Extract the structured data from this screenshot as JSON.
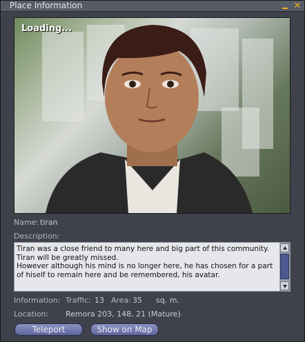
{
  "window": {
    "title": "Place Information"
  },
  "titlebar": {
    "minimize_icon": "minimize-icon",
    "close_icon": "close-icon",
    "close_glyph": "✕",
    "accent_color": "#f0b020"
  },
  "snapshot": {
    "overlay_text": "Loading..."
  },
  "fields": {
    "name_label": "Name:",
    "name_value": "tiran",
    "description_label": "Description:",
    "description_text": "Tiran was a close friend to many here and big part of this community.\nTiran will be greatly missed.\nHowever although his mind is no longer here, he has chosen for a part of hiself to remain here and be remembered, his avatar.",
    "info_label": "Information:",
    "traffic_label": "Traffic:",
    "traffic_value": "13",
    "area_label": "Area:",
    "area_value": "35",
    "area_unit": "sq. m.",
    "location_label": "Location:",
    "location_value": "Remora 203, 148, 21 (Mature)"
  },
  "buttons": {
    "teleport": "Teleport",
    "show_on_map": "Show on Map"
  }
}
